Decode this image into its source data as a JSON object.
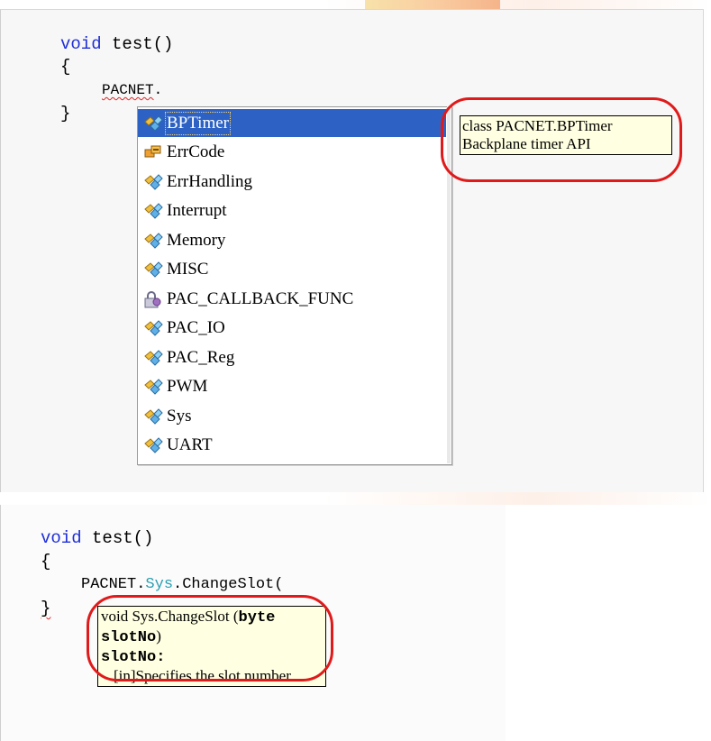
{
  "top_example": {
    "line1_kw": "void",
    "line1_rest": " test()",
    "line2": "{",
    "line3_obj": "PACNET",
    "line3_dot": ".",
    "line4": "}"
  },
  "autocomplete": {
    "items": [
      {
        "label": "BPTimer",
        "icon": "class-icon",
        "selected": true
      },
      {
        "label": "ErrCode",
        "icon": "enum-icon"
      },
      {
        "label": "ErrHandling",
        "icon": "class-icon"
      },
      {
        "label": "Interrupt",
        "icon": "class-icon"
      },
      {
        "label": "Memory",
        "icon": "class-icon"
      },
      {
        "label": "MISC",
        "icon": "class-icon"
      },
      {
        "label": "PAC_CALLBACK_FUNC",
        "icon": "delegate-lock-icon"
      },
      {
        "label": "PAC_IO",
        "icon": "class-icon"
      },
      {
        "label": "PAC_Reg",
        "icon": "class-icon"
      },
      {
        "label": "PWM",
        "icon": "class-icon"
      },
      {
        "label": "Sys",
        "icon": "class-icon"
      },
      {
        "label": "UART",
        "icon": "class-icon"
      }
    ]
  },
  "tooltip1": {
    "line1": "class PACNET.BPTimer",
    "line2": "Backplane timer API"
  },
  "bottom_example": {
    "line1_kw": "void",
    "line1_rest": " test()",
    "line2": "{",
    "line3_obj": "PACNET.",
    "line3_type": "Sys",
    "line3_rest": ".ChangeSlot(",
    "line4": "}"
  },
  "tooltip2": {
    "sig_prefix": "void Sys.ChangeSlot (",
    "sig_param": "byte slotNo",
    "sig_suffix": ")",
    "param_name": "slotNo:",
    "param_desc": "[in]Specifies the slot number."
  },
  "colors": {
    "keyword": "#1f2fd8",
    "type": "#2a9fb0",
    "highlight_ring": "#e01a1a",
    "tooltip_bg": "#ffffe1",
    "selection": "#2d62c4"
  }
}
